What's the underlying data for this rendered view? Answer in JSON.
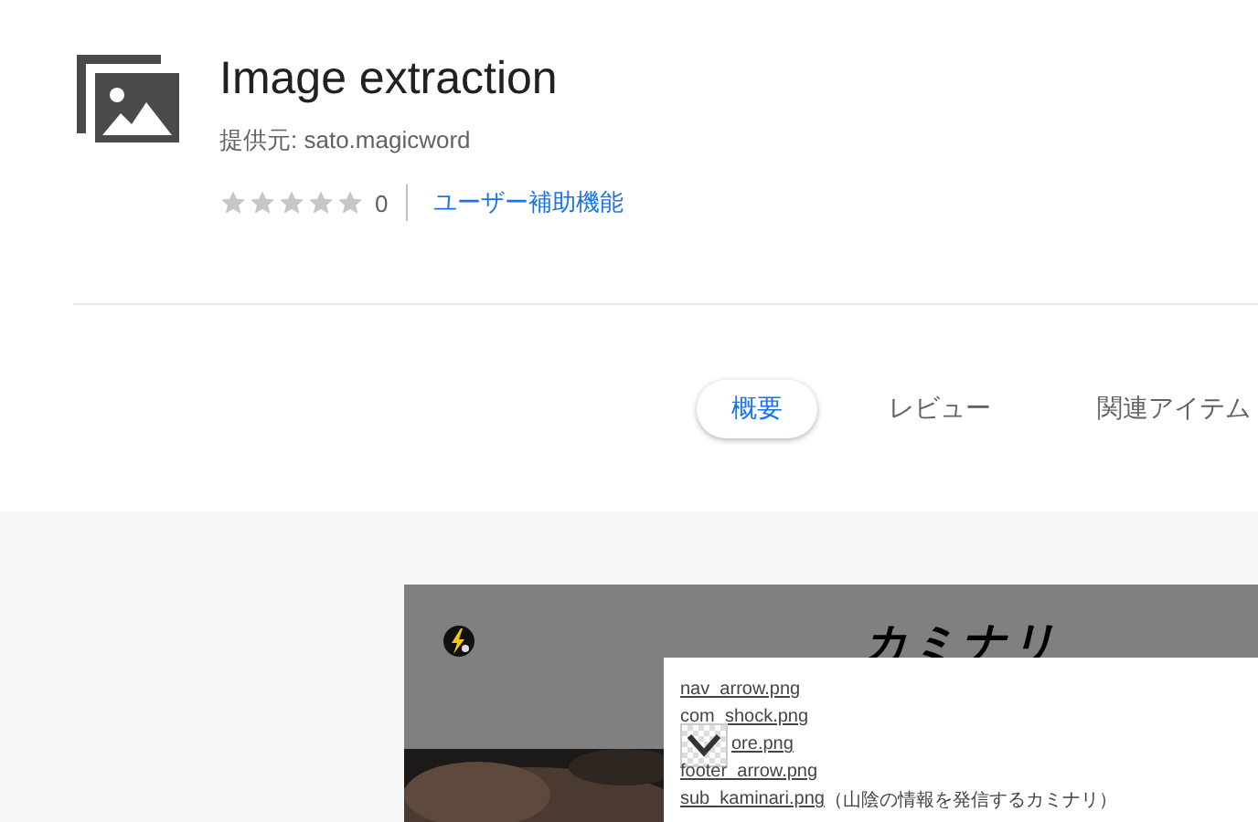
{
  "extension": {
    "title": "Image extraction",
    "provider": "提供元: sato.magicword",
    "stars": 0,
    "rating_count": "0",
    "category": "ユーザー補助機能"
  },
  "tabs": [
    {
      "label": "概要",
      "selected": true
    },
    {
      "label": "レビュー",
      "selected": false
    },
    {
      "label": "関連アイテム",
      "selected": false
    }
  ],
  "screenshot": {
    "site_logo": "カミナリ",
    "files": [
      {
        "name": "nav_arrow.png",
        "thumbnail": false
      },
      {
        "name": "com_shock.png",
        "thumbnail": false
      },
      {
        "name": "ore.png",
        "thumbnail": true
      },
      {
        "name": "footer_arrow.png",
        "thumbnail": false
      },
      {
        "name": "sub_kaminari.png",
        "note": "（山陰の情報を発信するカミナリ）",
        "thumbnail": false
      }
    ]
  }
}
